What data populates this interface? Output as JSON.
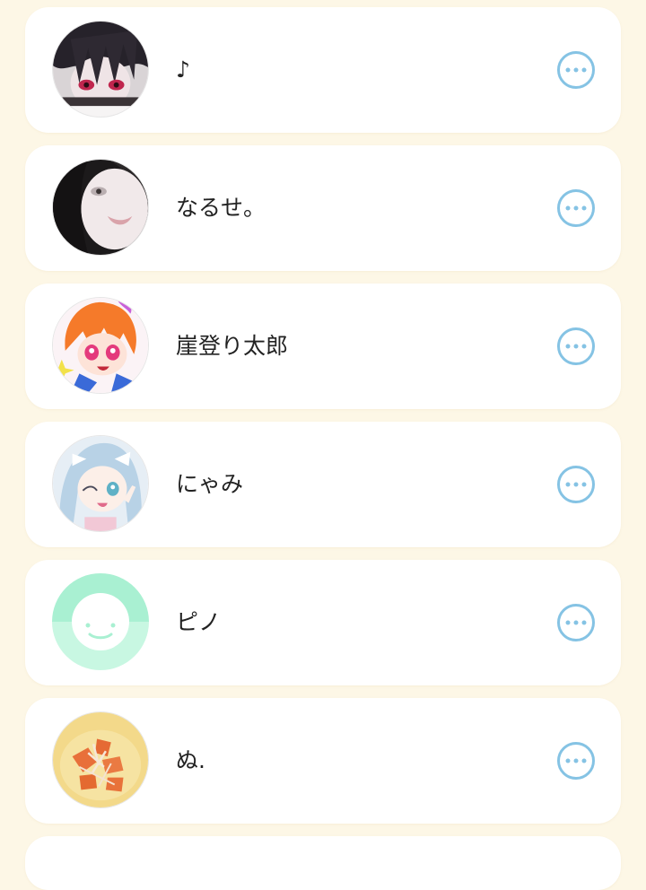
{
  "theme": {
    "background": "#fdf7e6",
    "card": "#ffffff",
    "accent": "#85c3e4",
    "text": "#222222"
  },
  "users": [
    {
      "name": "♪",
      "avatar_icon": "dark-haired-character-avatar"
    },
    {
      "name": "なるせ。",
      "avatar_icon": "pale-face-portrait-avatar"
    },
    {
      "name": "崖登り太郎",
      "avatar_icon": "orange-haired-anime-girl-avatar"
    },
    {
      "name": "にゃみ",
      "avatar_icon": "blue-haired-anime-girl-avatar"
    },
    {
      "name": "ピノ",
      "avatar_icon": "default-smiley-avatar"
    },
    {
      "name": "ぬ.",
      "avatar_icon": "food-photo-avatar"
    }
  ],
  "more_button_icon": "more-options-icon"
}
